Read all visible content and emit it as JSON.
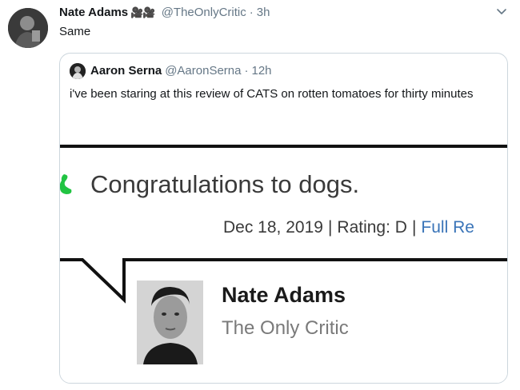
{
  "tweet": {
    "display_name": "Nate Adams",
    "name_emoji": "🎥🎥",
    "handle": "@TheOnlyCritic",
    "dot": "·",
    "time": "3h",
    "text": "Same"
  },
  "quoted_tweet": {
    "display_name": "Aaron Serna",
    "handle": "@AaronSerna",
    "dot": "·",
    "time": "12h",
    "text": "i've been staring at this review of CATS on rotten tomatoes for thirty minutes"
  },
  "review_image": {
    "quote": "Congratulations to dogs.",
    "date": "Dec 18, 2019",
    "separator": "|",
    "rating": "Rating: D",
    "link": "Full Re",
    "critic_name": "Nate Adams",
    "publication": "The Only Critic"
  },
  "icons": {
    "caret": "chevron-down-icon",
    "green_mark": "rotten-splat-icon"
  },
  "colors": {
    "link_blue": "#3a74b8",
    "mark_green": "#21c442",
    "muted": "#657786"
  }
}
